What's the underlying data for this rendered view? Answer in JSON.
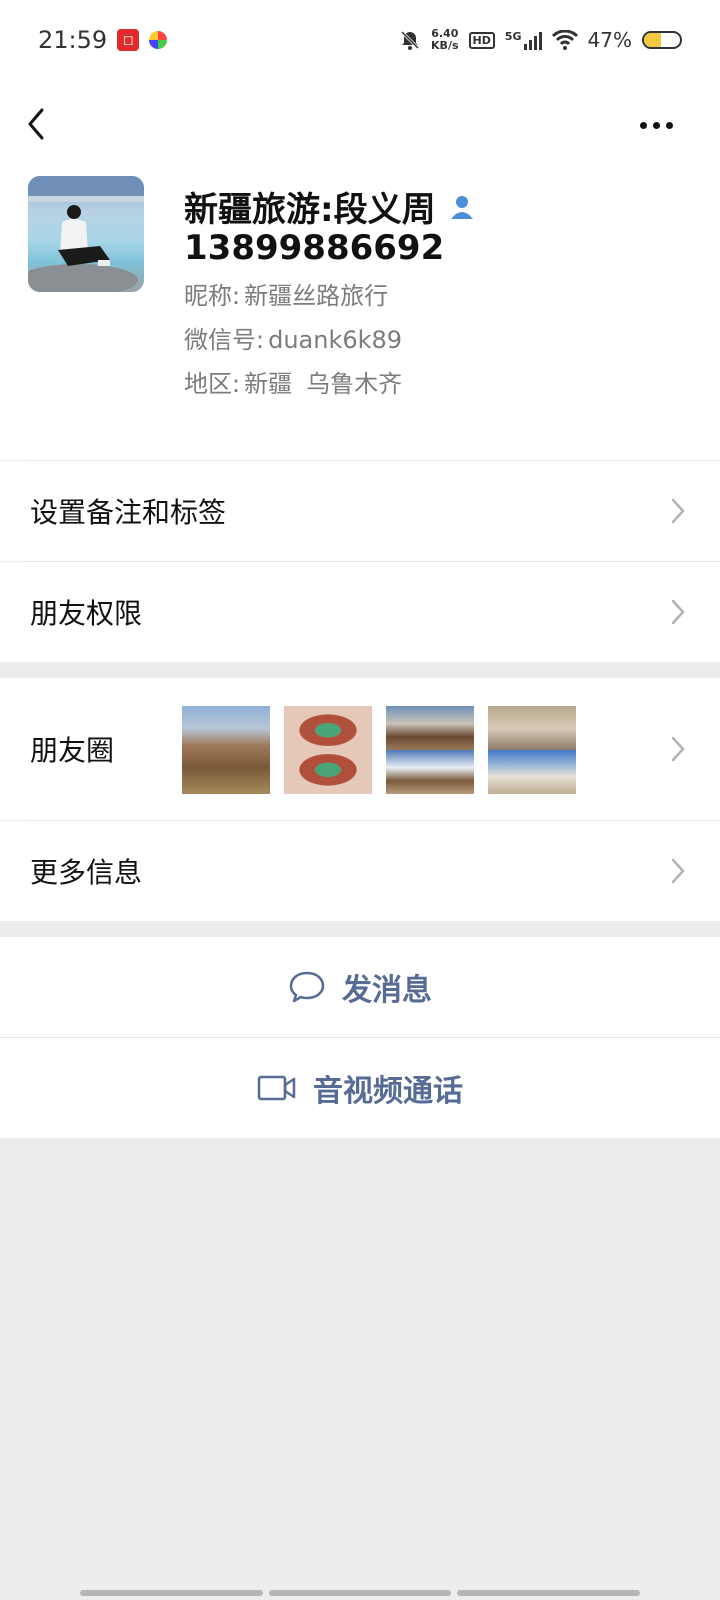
{
  "status": {
    "time": "21:59",
    "speed_value": "6.40",
    "speed_unit": "KB/s",
    "hd": "HD",
    "network": "5G",
    "battery": "47%",
    "battery_level": 0.47,
    "icons": [
      "notification-app-icon",
      "colorful-app-icon",
      "mute-bell-icon",
      "signal-icon",
      "wifi-icon",
      "battery-icon"
    ]
  },
  "nav": {
    "back_icon": "chevron-left-icon",
    "more_icon": "more-dots-icon"
  },
  "profile": {
    "display_name": "新疆旅游:段义周",
    "phone": "13899886692",
    "nickname_label": "昵称:",
    "nickname": "新疆丝路旅行",
    "wechat_id_label": "微信号:",
    "wechat_id": "duank6k89",
    "region_label": "地区:",
    "region_province": "新疆",
    "region_city": "乌鲁木齐",
    "contact_icon": "person-icon"
  },
  "rows": {
    "remark": "设置备注和标签",
    "permissions": "朋友权限",
    "moments": "朋友圈",
    "more_info": "更多信息"
  },
  "actions": {
    "message": "发消息",
    "call": "音视频通话"
  },
  "colors": {
    "link": "#576b95",
    "background": "#ededed",
    "surface": "#ffffff"
  }
}
